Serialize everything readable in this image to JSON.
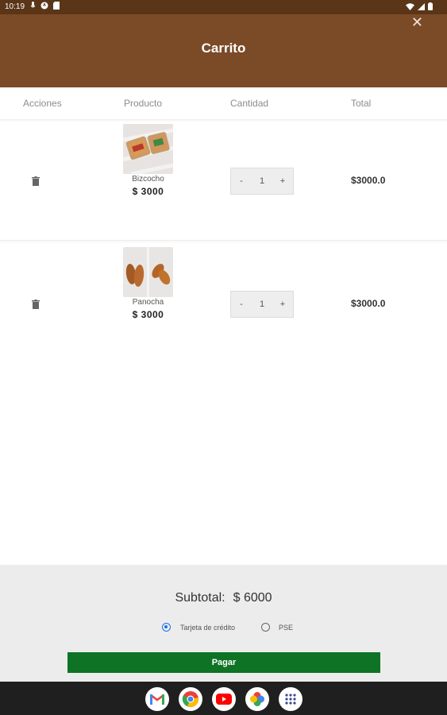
{
  "status_bar": {
    "time": "10:19"
  },
  "header": {
    "title": "Carrito",
    "close_glyph": "✕"
  },
  "columns": {
    "actions": "Acciones",
    "product": "Producto",
    "quantity": "Cantidad",
    "total": "Total"
  },
  "items": [
    {
      "name": "Bizcocho",
      "price": "$ 3000",
      "quantity": "1",
      "total": "$3000.0",
      "minus": "-",
      "plus": "+"
    },
    {
      "name": "Panocha",
      "price": "$ 3000",
      "quantity": "1",
      "total": "$3000.0",
      "minus": "-",
      "plus": "+"
    }
  ],
  "summary": {
    "subtotal_label": "Subtotal:",
    "subtotal_value": "$ 6000"
  },
  "payment": {
    "options": [
      {
        "label": "Tarjeta de crédito",
        "selected": true
      },
      {
        "label": "PSE",
        "selected": false
      }
    ],
    "button": "Pagar"
  },
  "colors": {
    "header": "#7b4a27",
    "status_bar": "#5a3518",
    "pay_button": "#0e7324",
    "radio_selected": "#1a73e8"
  },
  "nav_apps": [
    "gmail-icon",
    "chrome-icon",
    "youtube-icon",
    "photos-icon",
    "app-drawer-icon"
  ]
}
